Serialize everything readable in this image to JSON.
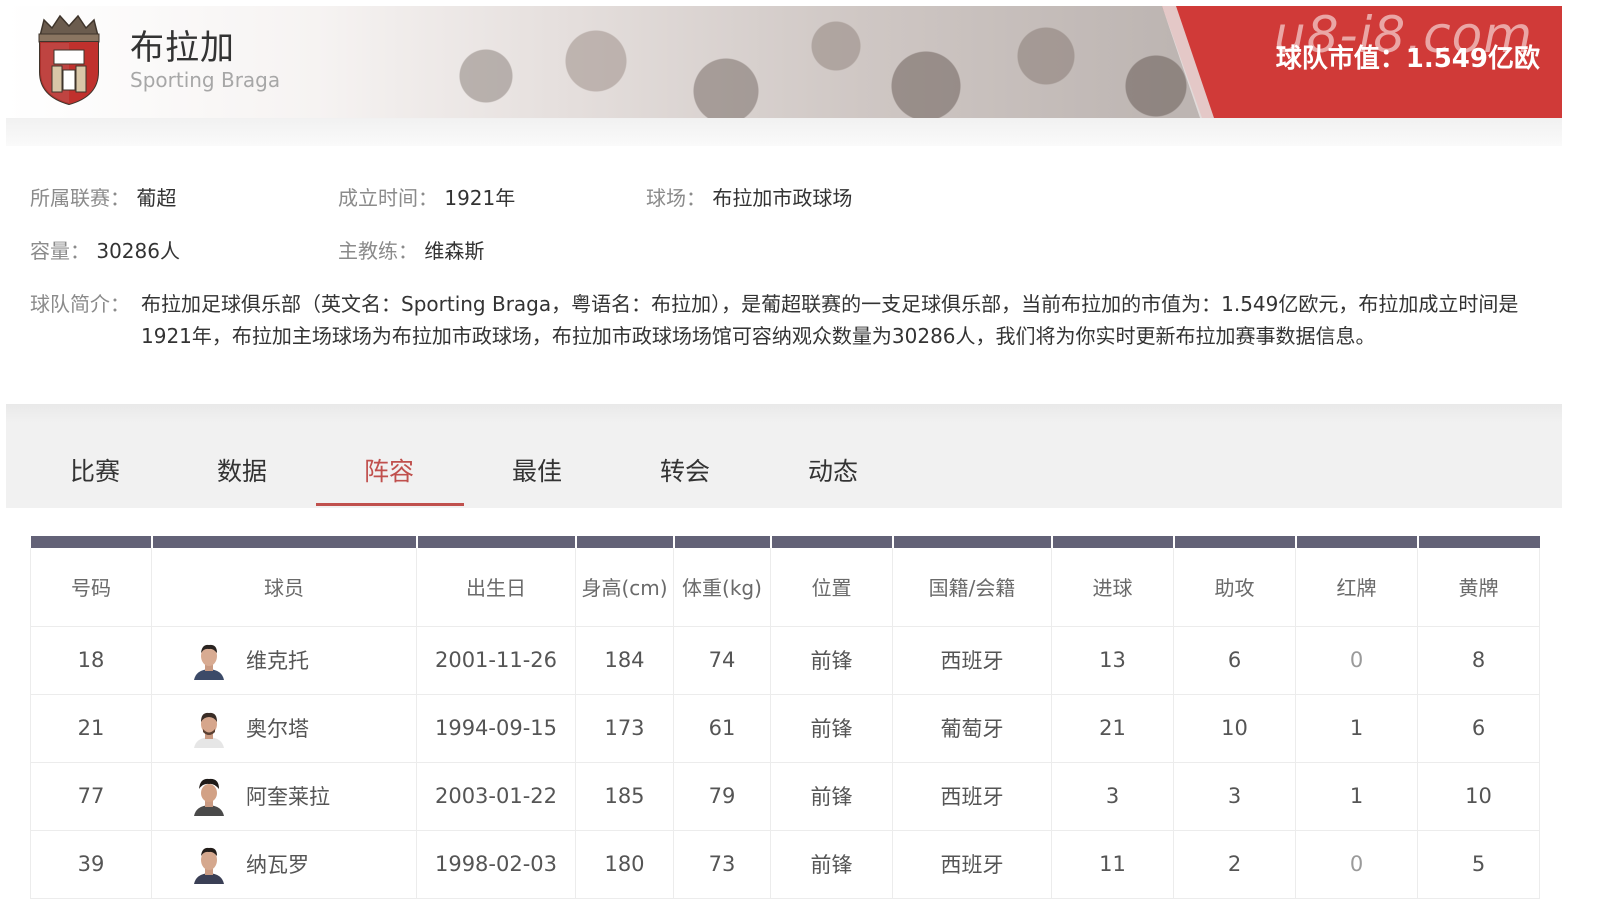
{
  "header": {
    "team_name": "布拉加",
    "team_en": "Sporting Braga",
    "market_value": "球队市值：1.549亿欧",
    "watermark": "u8-i8.com"
  },
  "info": {
    "league_label": "所属联赛：",
    "league": "葡超",
    "founded_label": "成立时间：",
    "founded": "1921年",
    "stadium_label": "球场：",
    "stadium": "布拉加市政球场",
    "capacity_label": "容量：",
    "capacity": "30286人",
    "coach_label": "主教练：",
    "coach": "维森斯",
    "intro_label": "球队简介：",
    "intro_text": "布拉加足球俱乐部（英文名：Sporting Braga，粤语名：布拉加），是葡超联赛的一支足球俱乐部，当前布拉加的市值为：1.549亿欧元，布拉加成立时间是1921年，布拉加主场球场为布拉加市政球场，布拉加市政球场场馆可容纳观众数量为30286人，我们将为你实时更新布拉加赛事数据信息。"
  },
  "tabs": [
    {
      "label": "比赛",
      "active": false
    },
    {
      "label": "数据",
      "active": false
    },
    {
      "label": "阵容",
      "active": true
    },
    {
      "label": "最佳",
      "active": false
    },
    {
      "label": "转会",
      "active": false
    },
    {
      "label": "动态",
      "active": false
    }
  ],
  "colors": {
    "accent": "#c0504d",
    "banner_red": "#d03a38",
    "table_header_bar": "#636277"
  },
  "table": {
    "headers": [
      "号码",
      "球员",
      "出生日",
      "身高(cm)",
      "体重(kg)",
      "位置",
      "国籍/会籍",
      "进球",
      "助攻",
      "红牌",
      "黄牌"
    ],
    "rows": [
      {
        "number": "18",
        "name": "维克托",
        "birth": "2001-11-26",
        "height": "184",
        "weight": "74",
        "position": "前锋",
        "nationality": "西班牙",
        "goals": "13",
        "assists": "6",
        "red": "0",
        "yellow": "8"
      },
      {
        "number": "21",
        "name": "奥尔塔",
        "birth": "1994-09-15",
        "height": "173",
        "weight": "61",
        "position": "前锋",
        "nationality": "葡萄牙",
        "goals": "21",
        "assists": "10",
        "red": "1",
        "yellow": "6"
      },
      {
        "number": "77",
        "name": "阿奎莱拉",
        "birth": "2003-01-22",
        "height": "185",
        "weight": "79",
        "position": "前锋",
        "nationality": "西班牙",
        "goals": "3",
        "assists": "3",
        "red": "1",
        "yellow": "10"
      },
      {
        "number": "39",
        "name": "纳瓦罗",
        "birth": "1998-02-03",
        "height": "180",
        "weight": "73",
        "position": "前锋",
        "nationality": "西班牙",
        "goals": "11",
        "assists": "2",
        "red": "0",
        "yellow": "5"
      }
    ]
  }
}
